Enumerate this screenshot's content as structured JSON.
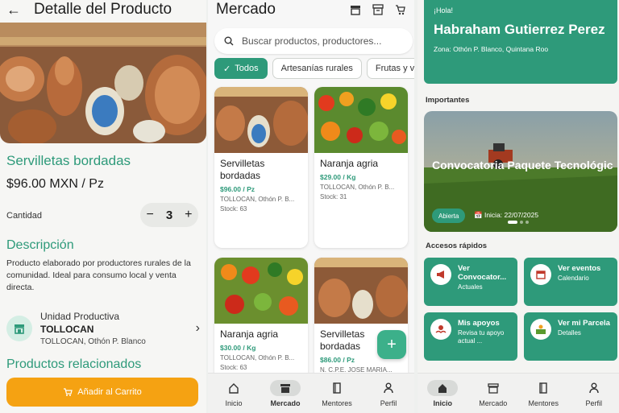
{
  "detail": {
    "title": "Detalle del Producto",
    "product_name": "Servilletas bordadas",
    "price": "$96.00 MXN / Pz",
    "quantity_label": "Cantidad",
    "quantity": "3",
    "description_title": "Descripción",
    "description": "Producto elaborado por productores rurales de la comunidad. Ideal para consumo local y venta directa.",
    "unit_label": "Unidad Productiva",
    "unit_name": "TOLLOCAN",
    "unit_location": "TOLLOCAN, Othón P. Blanco",
    "related_title": "Productos relacionados",
    "add_to_cart": "Añadir al Carrito"
  },
  "market": {
    "title": "Mercado",
    "search_placeholder": "Buscar productos, productores...",
    "chips": [
      "Todos",
      "Artesanías rurales",
      "Frutas y ve"
    ],
    "products": [
      {
        "name": "Servilletas bordadas",
        "price": "$96.00 / Pz",
        "location": "TOLLOCAN, Othón P. B...",
        "stock": "Stock: 63"
      },
      {
        "name": "Naranja agria",
        "price": "$29.00 / Kg",
        "location": "TOLLOCAN, Othón P. B...",
        "stock": "Stock: 31"
      },
      {
        "name": "Naranja agria",
        "price": "$30.00 / Kg",
        "location": "TOLLOCAN, Othón P. B...",
        "stock": "Stock: 63"
      },
      {
        "name": "Servilletas bordadas",
        "price": "$86.00 / Pz",
        "location": "N. C.P.E. JOSE MARIA...",
        "stock": ""
      }
    ],
    "nav": [
      "Inicio",
      "Mercado",
      "Mentores",
      "Perfil"
    ]
  },
  "home": {
    "greeting": "¡Hola!",
    "user_name": "Habraham Gutierrez Perez",
    "zone": "Zona: Othón P. Blanco, Quintana Roo",
    "important_label": "Importantes",
    "banner_title": "Convocatoria Paquete Tecnológico Caña de Azúc...",
    "banner_status": "Abierta",
    "banner_date": "Inicia: 22/07/2025",
    "quick_label": "Accesos rápidos",
    "quick": [
      {
        "title": "Ver Convocator...",
        "subtitle": "Actuales"
      },
      {
        "title": "Ver eventos",
        "subtitle": "Calendario"
      },
      {
        "title": "Mis apoyos",
        "subtitle": "Revisa tu apoyo actual ..."
      },
      {
        "title": "Ver mi Parcela",
        "subtitle": "Detalles"
      }
    ],
    "nav": [
      "Inicio",
      "Mercado",
      "Mentores",
      "Perfil"
    ]
  },
  "colors": {
    "primary": "#2e9a7a",
    "cart": "#f5a212"
  }
}
